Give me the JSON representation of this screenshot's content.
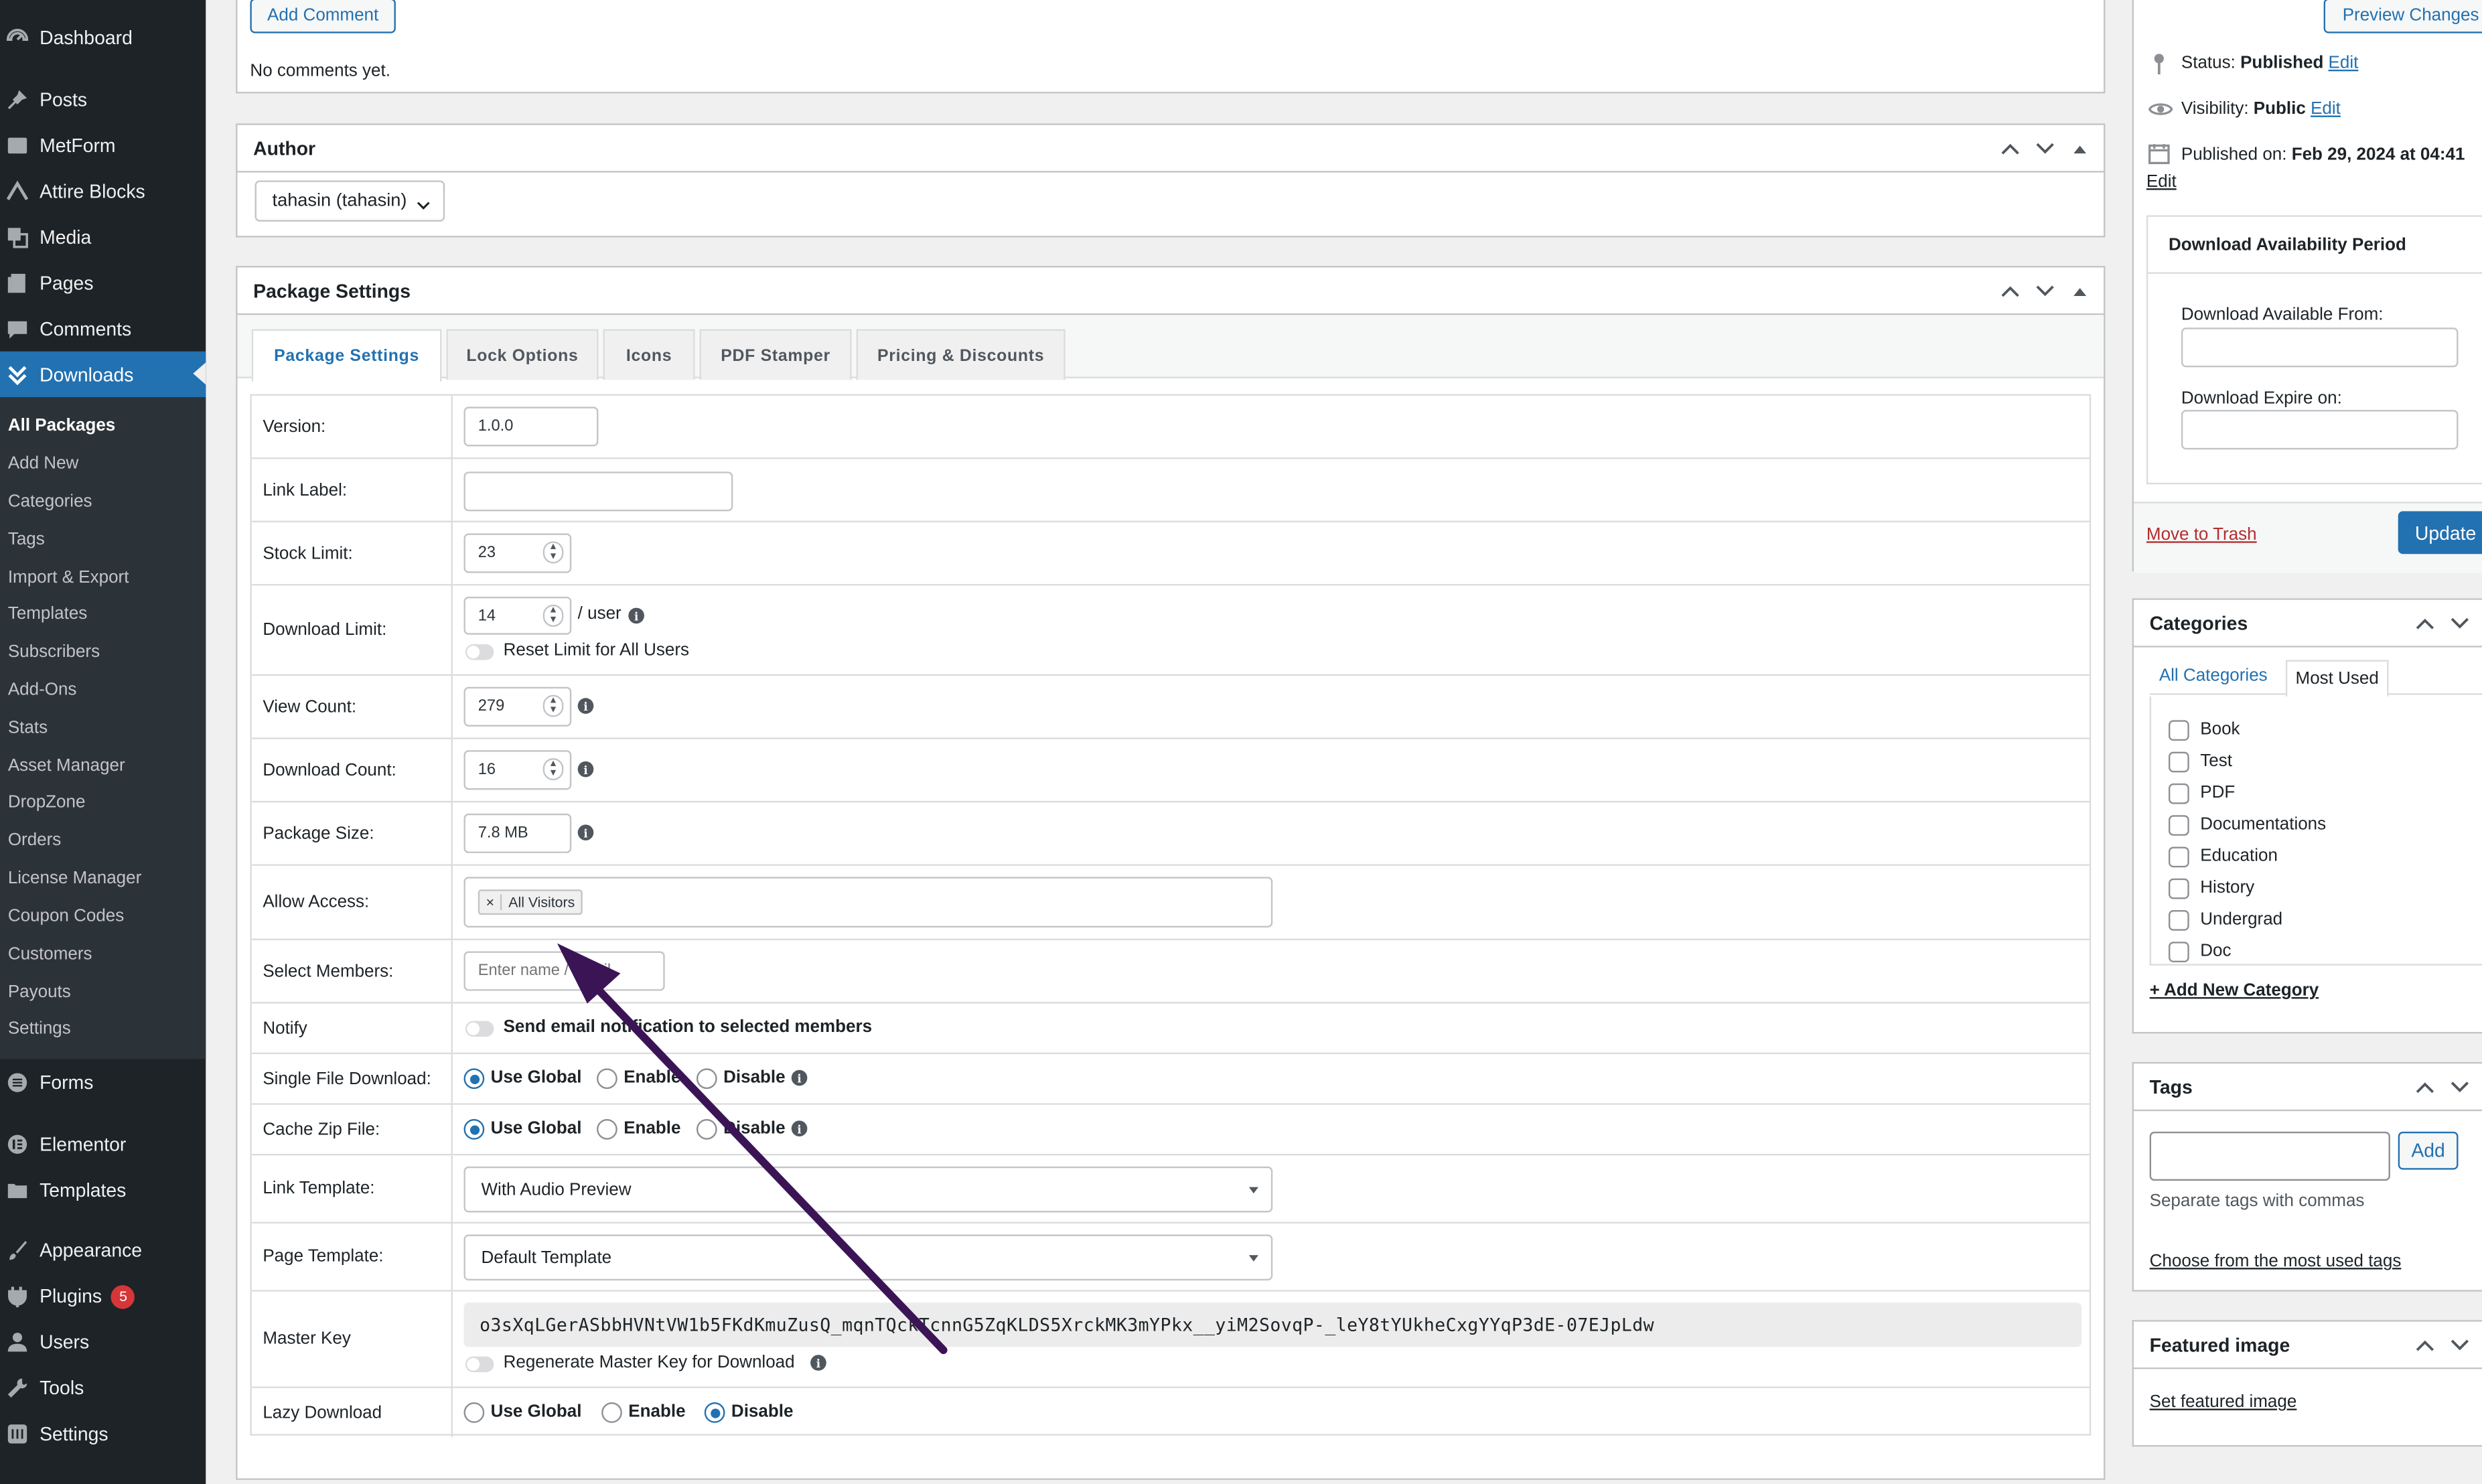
{
  "sidebar": {
    "top_items": [
      {
        "label": "Dashboard",
        "icon": "dashboard-icon"
      },
      {
        "label": "Posts",
        "icon": "pin-icon"
      },
      {
        "label": "MetForm",
        "icon": "form-icon"
      },
      {
        "label": "Attire Blocks",
        "icon": "blocks-icon"
      },
      {
        "label": "Media",
        "icon": "media-icon"
      },
      {
        "label": "Pages",
        "icon": "pages-icon"
      },
      {
        "label": "Comments",
        "icon": "comments-icon"
      },
      {
        "label": "Downloads",
        "icon": "download-icon"
      }
    ],
    "submenu": [
      "All Packages",
      "Add New",
      "Categories",
      "Tags",
      "Import & Export",
      "Templates",
      "Subscribers",
      "Add-Ons",
      "Stats",
      "Asset Manager",
      "DropZone",
      "Orders",
      "License Manager",
      "Coupon Codes",
      "Customers",
      "Payouts",
      "Settings"
    ],
    "bottom_items": [
      {
        "label": "Forms",
        "icon": "forms-icon"
      },
      {
        "label": "Elementor",
        "icon": "elementor-icon"
      },
      {
        "label": "Templates",
        "icon": "folder-icon"
      },
      {
        "label": "Appearance",
        "icon": "brush-icon"
      },
      {
        "label": "Plugins",
        "icon": "plugin-icon",
        "badge": "5"
      },
      {
        "label": "Users",
        "icon": "user-icon"
      },
      {
        "label": "Tools",
        "icon": "wrench-icon"
      },
      {
        "label": "Settings",
        "icon": "settings-icon"
      }
    ],
    "active_color": "#2271b1"
  },
  "comments": {
    "add_button": "Add Comment",
    "empty_text": "No comments yet."
  },
  "author": {
    "title": "Author",
    "selected": "tahasin (tahasin)"
  },
  "package": {
    "title": "Package Settings",
    "tabs": [
      "Package Settings",
      "Lock Options",
      "Icons",
      "PDF Stamper",
      "Pricing & Discounts"
    ],
    "labels": {
      "version": "Version:",
      "link_label": "Link Label:",
      "stock_limit": "Stock Limit:",
      "download_limit": "Download Limit:",
      "view_count": "View Count:",
      "download_count": "Download Count:",
      "package_size": "Package Size:",
      "allow_access": "Allow Access:",
      "select_members": "Select Members:",
      "notify": "Notify",
      "single_file": "Single File Download:",
      "cache_zip": "Cache Zip File:",
      "link_template": "Link Template:",
      "page_template": "Page Template:",
      "master_key": "Master Key",
      "lazy_download": "Lazy Download"
    },
    "values": {
      "version": "1.0.0",
      "link_label": "",
      "stock_limit": "23",
      "download_limit": "14",
      "per_user": "/ user",
      "reset_limit": "Reset Limit for All Users",
      "view_count": "279",
      "download_count": "16",
      "package_size": "7.8 MB",
      "access_tag": "All Visitors",
      "access_tag_remove": "×",
      "members_placeholder": "Enter name / email",
      "notify_text": "Send email notification to selected members",
      "link_template": "With Audio Preview",
      "page_template": "Default Template",
      "master_key": "o3sXqLGerASbbHVNtVW1b5FKdKmuZusQ_mqnTQckTcnnG5ZqKLDS5XrckMK3mYPkx__yiM2SovqP-_leY8tYUkheCxgYYqP3dE-07EJpLdw",
      "regenerate": "Regenerate Master Key for Download"
    },
    "radio_options": {
      "global": "Use Global",
      "enable": "Enable",
      "disable": "Disable"
    },
    "radio_state": {
      "single_file": "Use Global",
      "cache_zip": "Use Global",
      "lazy_download": "Disable"
    }
  },
  "publish": {
    "preview_button": "Preview Changes",
    "status_label": "Status:",
    "status_value": "Published",
    "visibility_label": "Visibility:",
    "visibility_value": "Public",
    "published_label": "Published on:",
    "published_value": "Feb 29, 2024 at 04:41",
    "edit": "Edit",
    "availability_title": "Download Availability Period",
    "available_from": "Download Available From:",
    "expire_on": "Download Expire on:",
    "trash": "Move to Trash",
    "update": "Update"
  },
  "categories": {
    "title": "Categories",
    "tabs": [
      "All Categories",
      "Most Used"
    ],
    "items": [
      "Book",
      "Test",
      "PDF",
      "Documentations",
      "Education",
      "History",
      "Undergrad",
      "Doc"
    ],
    "add_new": "+ Add New Category"
  },
  "tags": {
    "title": "Tags",
    "add_button": "Add",
    "hint": "Separate tags with commas",
    "choose": "Choose from the most used tags"
  },
  "featured": {
    "title": "Featured image",
    "set": "Set featured image"
  },
  "annotation": {
    "arrow_color": "#3b1456"
  }
}
